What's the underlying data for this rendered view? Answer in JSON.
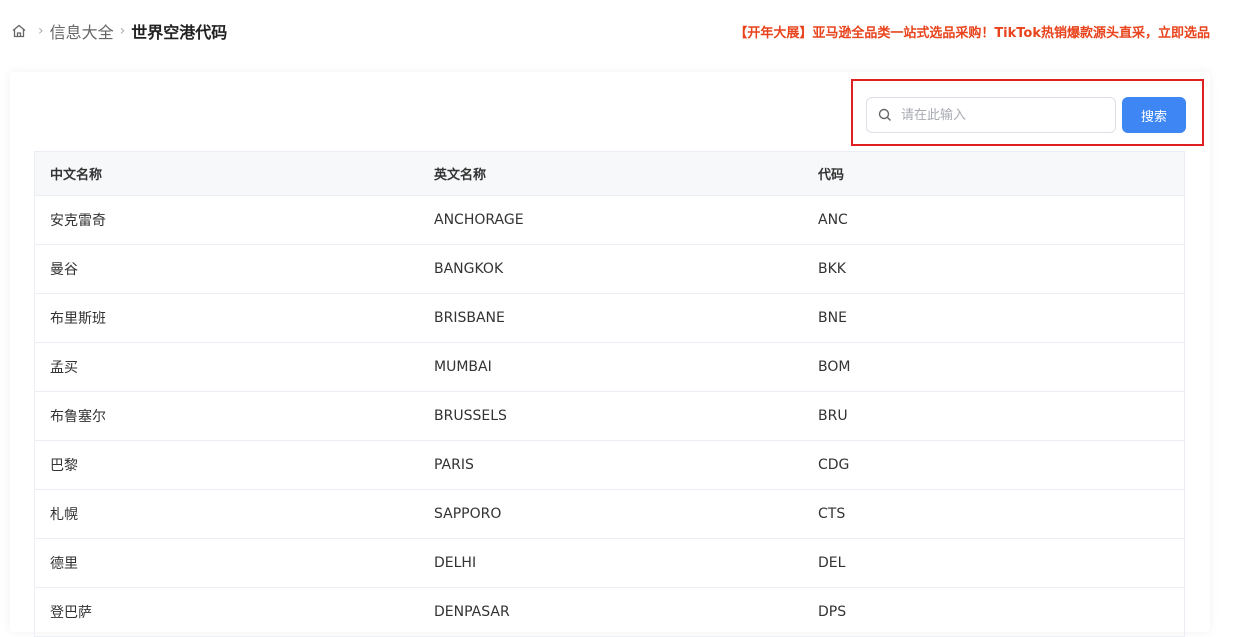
{
  "breadcrumb": {
    "home_icon": "home-icon",
    "parent": "信息大全",
    "current": "世界空港代码"
  },
  "promo": "【开年大展】亚马逊全品类一站式选品采购！TikTok热销爆款源头直采，立即选品",
  "search": {
    "placeholder": "请在此输入",
    "value": "",
    "button_label": "搜索",
    "icon": "search-icon"
  },
  "table": {
    "columns": [
      "中文名称",
      "英文名称",
      "代码"
    ],
    "rows": [
      [
        "安克雷奇",
        "ANCHORAGE",
        "ANC"
      ],
      [
        "曼谷",
        "BANGKOK",
        "BKK"
      ],
      [
        "布里斯班",
        "BRISBANE",
        "BNE"
      ],
      [
        "孟买",
        "MUMBAI",
        "BOM"
      ],
      [
        "布鲁塞尔",
        "BRUSSELS",
        "BRU"
      ],
      [
        "巴黎",
        "PARIS",
        "CDG"
      ],
      [
        "札幌",
        "SAPPORO",
        "CTS"
      ],
      [
        "德里",
        "DELHI",
        "DEL"
      ],
      [
        "登巴萨",
        "DENPASAR",
        "DPS"
      ]
    ]
  },
  "colors": {
    "accent": "#3d86f4",
    "promo": "#e8431c",
    "highlight": "#e02020"
  }
}
